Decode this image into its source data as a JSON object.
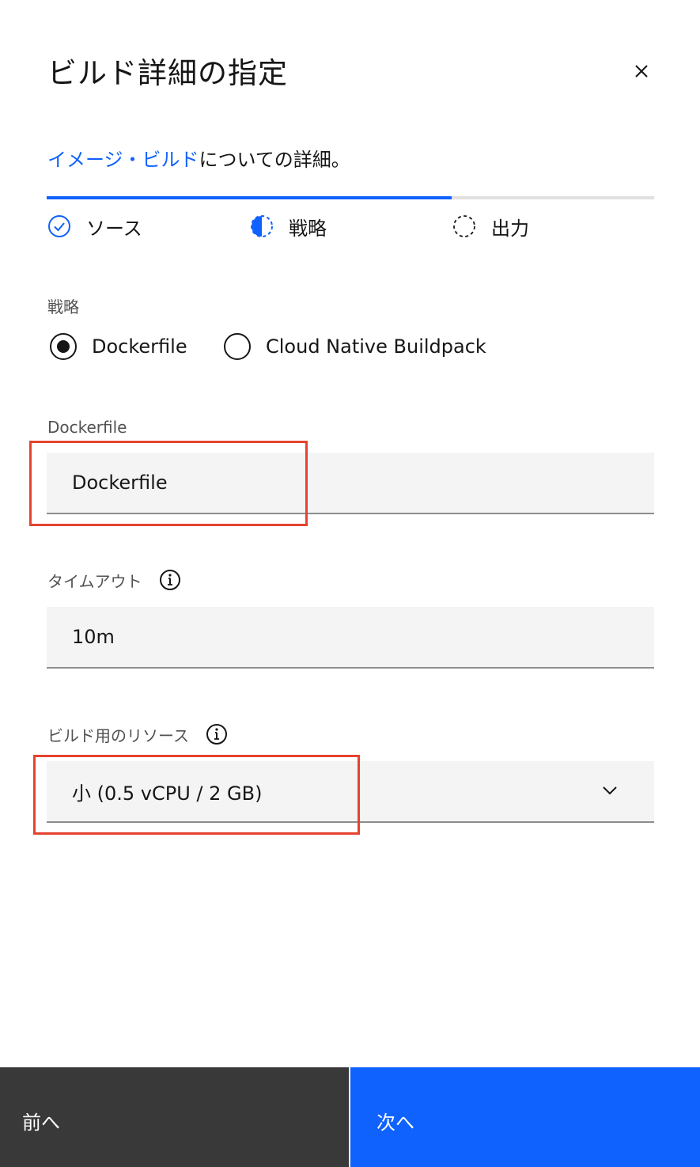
{
  "header": {
    "title": "ビルド詳細の指定"
  },
  "subtitle": {
    "link_text": "イメージ・ビルド",
    "rest_text": "についての詳細。"
  },
  "progress": {
    "fraction": 0.667,
    "steps": [
      {
        "label": "ソース",
        "state": "complete"
      },
      {
        "label": "戦略",
        "state": "current"
      },
      {
        "label": "出力",
        "state": "incomplete"
      }
    ]
  },
  "strategy": {
    "label": "戦略",
    "options": [
      {
        "label": "Dockerfile",
        "selected": true
      },
      {
        "label": "Cloud Native Buildpack",
        "selected": false
      }
    ]
  },
  "dockerfile_field": {
    "label": "Dockerfile",
    "value": "Dockerfile"
  },
  "timeout_field": {
    "label": "タイムアウト",
    "value": "10m"
  },
  "resources_field": {
    "label": "ビルド用のリソース",
    "value": "小 (0.5 vCPU / 2 GB)"
  },
  "footer": {
    "back_label": "前へ",
    "next_label": "次へ"
  },
  "colors": {
    "accent": "#0f62fe",
    "highlight": "#e5432f",
    "secondary_button": "#393939",
    "field_background": "#f4f4f4"
  },
  "icons": {
    "close": "close-icon",
    "step_complete": "checkmark-circle-icon",
    "step_current": "half-circle-icon",
    "step_incomplete": "dashed-circle-icon",
    "info": "info-icon",
    "dropdown": "chevron-down-icon"
  }
}
